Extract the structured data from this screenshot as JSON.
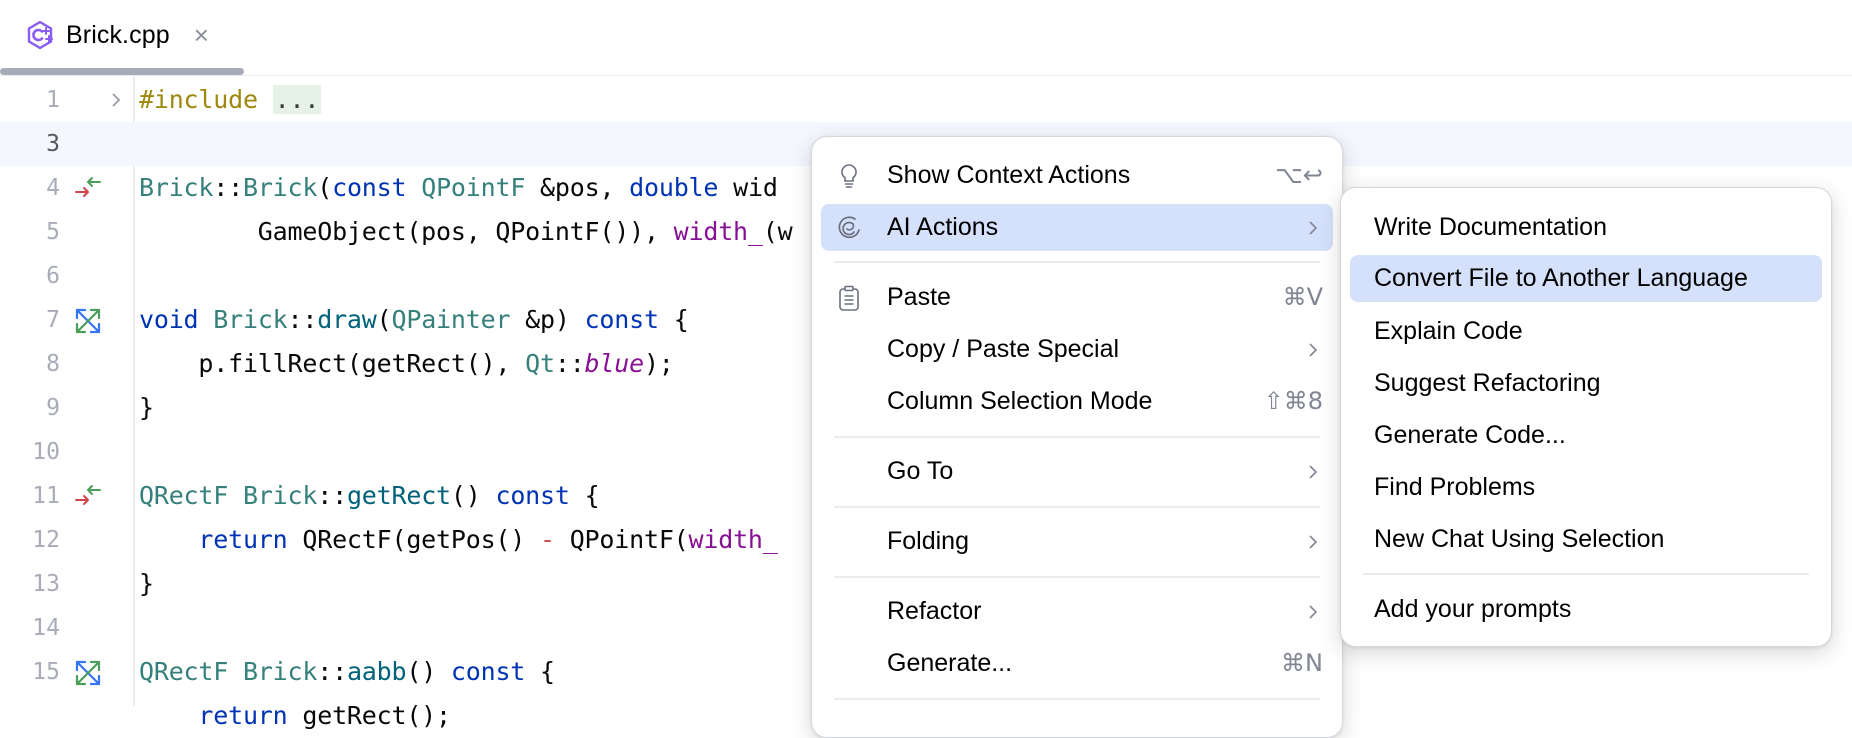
{
  "tab": {
    "icon": "cpp-file-icon",
    "title": "Brick.cpp",
    "close_glyph": "×"
  },
  "editor": {
    "current_line": 3,
    "lines": [
      {
        "n": "1",
        "gutter": "fold-arrow"
      },
      {
        "n": "3",
        "gutter": ""
      },
      {
        "n": "4",
        "gutter": "declaration-definition-icon"
      },
      {
        "n": "5",
        "gutter": ""
      },
      {
        "n": "6",
        "gutter": ""
      },
      {
        "n": "7",
        "gutter": "override-icon"
      },
      {
        "n": "8",
        "gutter": ""
      },
      {
        "n": "9",
        "gutter": ""
      },
      {
        "n": "10",
        "gutter": ""
      },
      {
        "n": "11",
        "gutter": "declaration-definition-icon"
      },
      {
        "n": "12",
        "gutter": ""
      },
      {
        "n": "13",
        "gutter": ""
      },
      {
        "n": "14",
        "gutter": ""
      },
      {
        "n": "15",
        "gutter": "override-icon"
      },
      {
        "n": "",
        "gutter": ""
      }
    ],
    "code": {
      "l1": {
        "kw": "#include",
        "sp": " ",
        "folded": "..."
      },
      "l4": {
        "a": "Brick",
        "b": "::",
        "c": "Brick",
        "d": "(",
        "e": "const",
        "f": " ",
        "g": "QPointF",
        "h": " &pos, ",
        "i": "double",
        "j": " wid"
      },
      "l5": {
        "a": "        GameObject(pos, QPointF()), ",
        "b": "width_",
        "c": "(w"
      },
      "l7": {
        "a": "void",
        "b": " ",
        "c": "Brick",
        "d": "::",
        "e": "draw",
        "f": "(",
        "g": "QPainter",
        "h": " &p) ",
        "i": "const",
        "j": " {"
      },
      "l8": {
        "a": "    p.fillRect(getRect(), ",
        "b": "Qt",
        "c": "::",
        "d": "blue",
        "e": ");"
      },
      "l9": {
        "a": "}"
      },
      "l11": {
        "a": "QRectF",
        "b": " ",
        "c": "Brick",
        "d": "::",
        "e": "getRect",
        "f": "() ",
        "g": "const",
        "h": " {"
      },
      "l12": {
        "a": "    ",
        "b": "return",
        "c": " QRectF(getPos() ",
        "d": "-",
        "e": " QPointF(",
        "f": "width_"
      },
      "l13": {
        "a": "}"
      },
      "l15": {
        "a": "QRectF",
        "b": " ",
        "c": "Brick",
        "d": "::",
        "e": "aabb",
        "f": "() ",
        "g": "const",
        "h": " {"
      },
      "l16": {
        "a": "    ",
        "b": "return",
        "c": " getRect();"
      }
    }
  },
  "context_menu": {
    "items": [
      {
        "label": "Show Context Actions",
        "icon": "lightbulb-icon",
        "shortcut": "⌥↩"
      },
      {
        "label": "AI Actions",
        "icon": "ai-assistant-icon",
        "submenu": true,
        "selected": true
      },
      {
        "label": "Paste",
        "icon": "clipboard-icon",
        "shortcut": "⌘V"
      },
      {
        "label": "Copy / Paste Special",
        "submenu": true
      },
      {
        "label": "Column Selection Mode",
        "shortcut": "⇧⌘8"
      },
      {
        "label": "Go To",
        "submenu": true
      },
      {
        "label": "Folding",
        "submenu": true
      },
      {
        "label": "Refactor",
        "submenu": true
      },
      {
        "label": "Generate...",
        "shortcut": "⌘N"
      }
    ]
  },
  "ai_submenu": {
    "items": [
      {
        "label": "Write Documentation"
      },
      {
        "label": "Convert File to Another Language",
        "selected": true
      },
      {
        "label": "Explain Code"
      },
      {
        "label": "Suggest Refactoring"
      },
      {
        "label": "Generate Code..."
      },
      {
        "label": "Find Problems"
      },
      {
        "label": "New Chat Using Selection"
      },
      {
        "label": "Add your prompts"
      }
    ]
  },
  "colors": {
    "selection_highlight": "#d5e0fb",
    "current_line": "#f5f7fe",
    "keyword": "#0033b3",
    "type": "#36807b",
    "member": "#871094",
    "preprocessor": "#9e880d",
    "fold_placeholder_bg": "#e6f2e6"
  }
}
